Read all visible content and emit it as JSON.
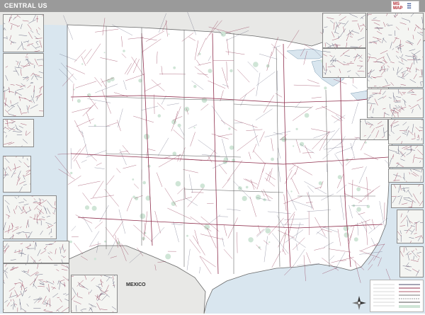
{
  "header": {
    "title": "CENTRAL US"
  },
  "map": {
    "country_label": "MEXICO",
    "colors": {
      "land": "#ffffff",
      "foreign_land": "#e8e8e6",
      "water": "#d9e6ef",
      "roads": "#8f2f4d",
      "highways": "#4a4a6a",
      "borders": "#6a6a6a",
      "urban": "#cfe5d6",
      "title_bar": "#9a9a9a"
    },
    "icons": [
      "compass-rose-icon",
      "brand-logo-icon"
    ]
  }
}
